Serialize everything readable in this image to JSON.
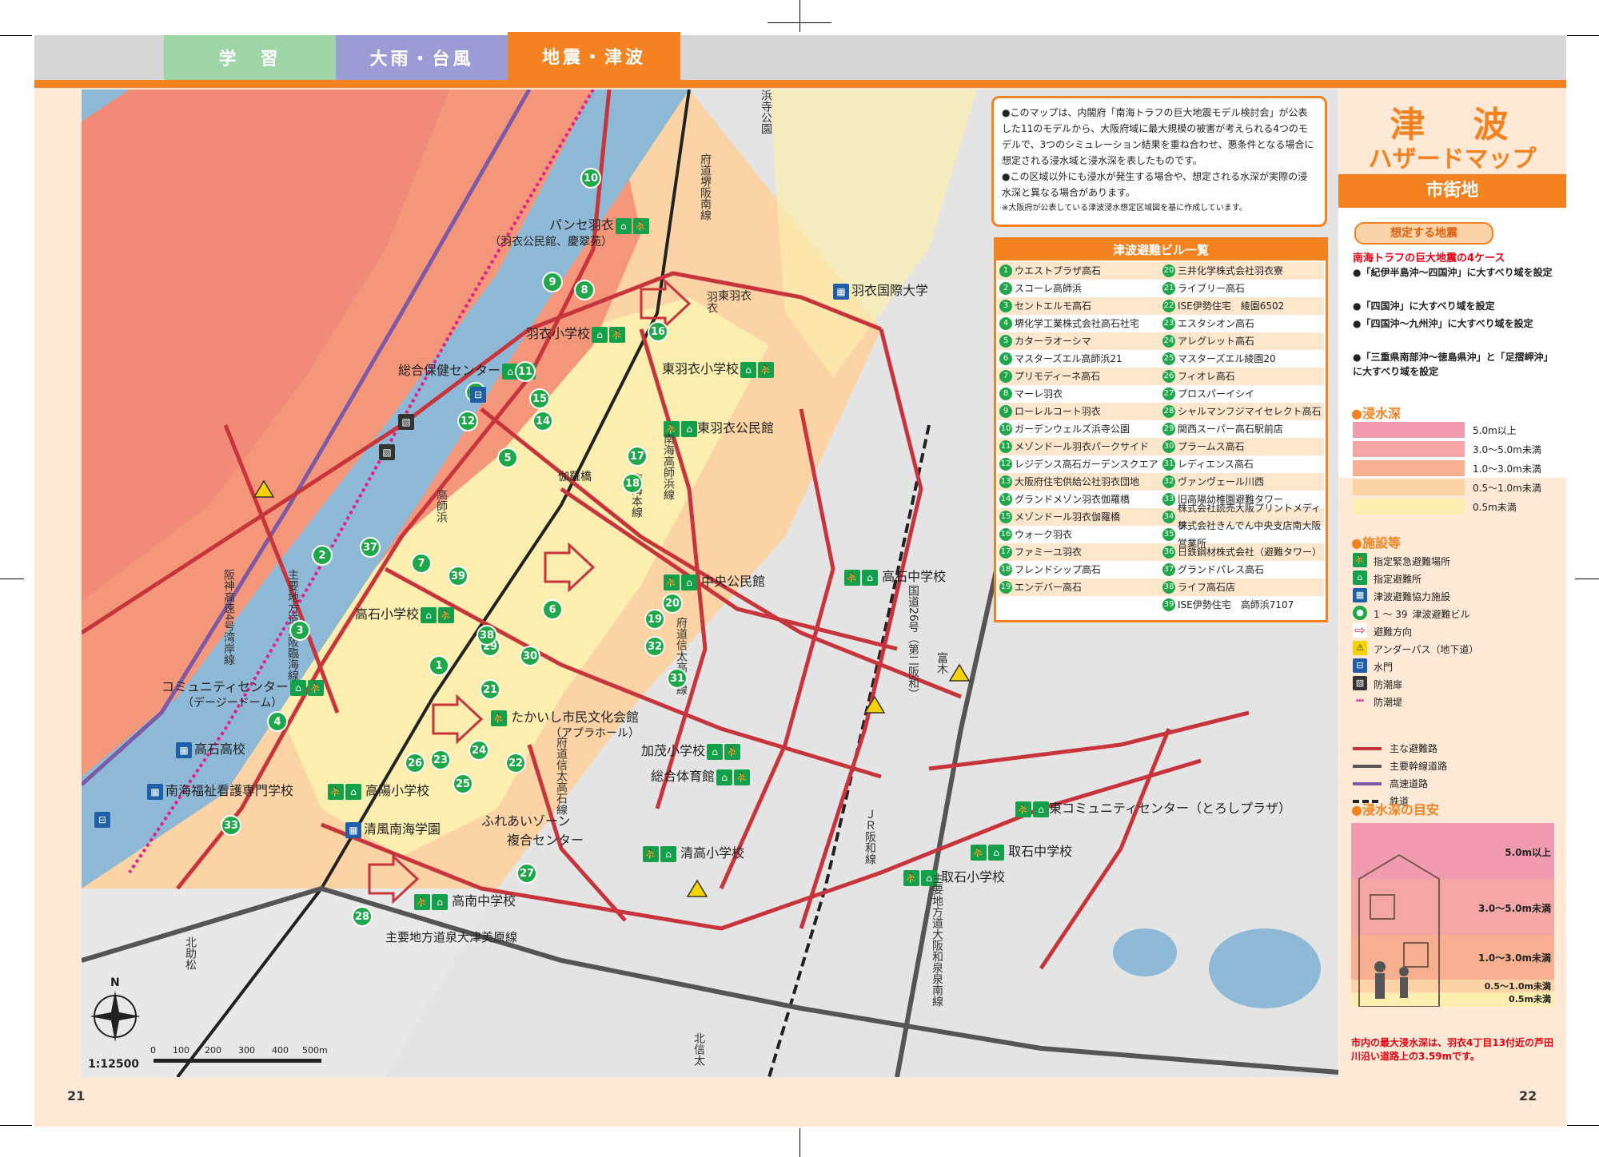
{
  "tabs": [
    {
      "label": "学　習",
      "color": "#9fd5a6"
    },
    {
      "label": "大雨・台風",
      "color": "#9b9bd6"
    },
    {
      "label": "地震・津波",
      "color": "#f58220"
    }
  ],
  "page_numbers": {
    "left": "21",
    "right": "22"
  },
  "map": {
    "scale_label": "1:12500",
    "scale_ticks": [
      "0",
      "100",
      "200",
      "300",
      "400",
      "500m"
    ],
    "compass_label": "N",
    "colors": {
      "depth_5plus": "#f19bb0",
      "depth_3_5": "#f4a6a6",
      "depth_1_3": "#f6b08f",
      "depth_05_1": "#fcd3a4",
      "depth_lt05": "#fbeeae",
      "water": "#8db8d6",
      "road_main": "#c8343c",
      "road_trunk": "#555555",
      "highway": "#7d5aa6"
    },
    "facilities": [
      {
        "name": "パンセ羽衣",
        "sub": "（羽衣公民館、慶翠苑）"
      },
      {
        "name": "羽衣小学校"
      },
      {
        "name": "総合保健センター"
      },
      {
        "name": "東羽衣小学校"
      },
      {
        "name": "東羽衣公民館"
      },
      {
        "name": "羽衣国際大学"
      },
      {
        "name": "高石小学校"
      },
      {
        "name": "中央公民館"
      },
      {
        "name": "高石中学校"
      },
      {
        "name": "コミュニティセンター",
        "sub": "（デージードーム）"
      },
      {
        "name": "たかいし市民文化会館",
        "sub": "（アプラホール）"
      },
      {
        "name": "高石高校"
      },
      {
        "name": "南海福祉看護専門学校"
      },
      {
        "name": "高陽小学校"
      },
      {
        "name": "加茂小学校"
      },
      {
        "name": "総合体育館"
      },
      {
        "name": "清風南海学園"
      },
      {
        "name": "ふれあいゾーン",
        "sub": "複合センター"
      },
      {
        "name": "清高小学校"
      },
      {
        "name": "東コミュニティセンター（とろしプラザ）"
      },
      {
        "name": "取石中学校"
      },
      {
        "name": "取石小学校"
      },
      {
        "name": "高南中学校"
      }
    ],
    "roads": [
      "浜寺公園",
      "府道堺阪南線",
      "東羽衣",
      "羽衣",
      "南海高師浜線",
      "伽羅橋",
      "高師浜",
      "南海本線",
      "主要地方道大阪臨海線",
      "阪神高速4号湾岸線",
      "府道信太高石線",
      "府道信太高石線",
      "国道26号（第二阪和）",
      "富木",
      "ＪＲ阪和線",
      "主要地方道大阪和泉泉南線",
      "主要地方道泉大津美原線",
      "北助松",
      "北信太"
    ],
    "markers": [
      "1",
      "2",
      "3",
      "4",
      "5",
      "6",
      "7",
      "8",
      "9",
      "10",
      "11",
      "12",
      "13",
      "14",
      "15",
      "16",
      "17",
      "18",
      "19",
      "20",
      "21",
      "22",
      "23",
      "24",
      "25",
      "26",
      "27",
      "28",
      "29",
      "30",
      "31",
      "32",
      "33",
      "37",
      "38",
      "39"
    ]
  },
  "info": {
    "lines": [
      "●このマップは、内閣府「南海トラフの巨大地震モデル検討会」が公表した11のモデルから、大阪府域に最大規模の被害が考えられる4つのモデルで、3つのシミュレーション結果を重ね合わせ、悪条件となる場合に想定される浸水域と浸水深を表したものです。",
      "●この区域以外にも浸水が発生する場合や、想定される水深が実際の浸水深と異なる場合があります。"
    ],
    "note": "※大阪府が公表している津波浸水想定区域図を基に作成しています。"
  },
  "building_list": {
    "title": "津波避難ビル一覧",
    "left": [
      {
        "n": "1",
        "name": "ウエストプラザ高石"
      },
      {
        "n": "2",
        "name": "スコーレ高師浜"
      },
      {
        "n": "3",
        "name": "セントエルモ高石"
      },
      {
        "n": "4",
        "name": "堺化学工業株式会社高石社宅"
      },
      {
        "n": "5",
        "name": "カターラオーシマ"
      },
      {
        "n": "6",
        "name": "マスターズエル高師浜21"
      },
      {
        "n": "7",
        "name": "プリモディーネ高石"
      },
      {
        "n": "8",
        "name": "マーレ羽衣"
      },
      {
        "n": "9",
        "name": "ローレルコート羽衣"
      },
      {
        "n": "10",
        "name": "ガーデンウェルズ浜寺公園"
      },
      {
        "n": "11",
        "name": "メゾンドール羽衣パークサイド"
      },
      {
        "n": "12",
        "name": "レジデンス高石ガーデンスクエア"
      },
      {
        "n": "13",
        "name": "大阪府住宅供給公社羽衣団地"
      },
      {
        "n": "14",
        "name": "グランドメゾン羽衣伽羅橋"
      },
      {
        "n": "15",
        "name": "メゾンドール羽衣伽羅橋"
      },
      {
        "n": "16",
        "name": "ウォーク羽衣"
      },
      {
        "n": "17",
        "name": "ファミーユ羽衣"
      },
      {
        "n": "18",
        "name": "フレンドシップ高石"
      },
      {
        "n": "19",
        "name": "エンデバー高石"
      }
    ],
    "right": [
      {
        "n": "20",
        "name": "三井化学株式会社羽衣寮"
      },
      {
        "n": "21",
        "name": "ライブリー高石"
      },
      {
        "n": "22",
        "name": "ISE伊勢住宅　綾園6502"
      },
      {
        "n": "23",
        "name": "エスタシオン高石"
      },
      {
        "n": "24",
        "name": "アレグレット高石"
      },
      {
        "n": "25",
        "name": "マスターズエル綾園20"
      },
      {
        "n": "26",
        "name": "フィオレ高石"
      },
      {
        "n": "27",
        "name": "プロスパーイシイ"
      },
      {
        "n": "28",
        "name": "シャルマンフジマイセレクト高石"
      },
      {
        "n": "29",
        "name": "関西スーパー高石駅前店"
      },
      {
        "n": "30",
        "name": "プラームス高石"
      },
      {
        "n": "31",
        "name": "レディエンス高石"
      },
      {
        "n": "32",
        "name": "ヴァンヴェール川西"
      },
      {
        "n": "33",
        "name": "旧高陽幼稚園避難タワー"
      },
      {
        "n": "34",
        "name": "株式会社読売大阪プリントメディア"
      },
      {
        "n": "35",
        "name": "株式会社きんでん中央支店南大阪営業所"
      },
      {
        "n": "36",
        "name": "日鉄鋼材株式会社（避難タワー）"
      },
      {
        "n": "37",
        "name": "グランドパレス高石"
      },
      {
        "n": "38",
        "name": "ライフ高石店"
      },
      {
        "n": "39",
        "name": "ISE伊勢住宅　高師浜7107"
      }
    ]
  },
  "side": {
    "title": "津　波",
    "subtitle": "ハザードマップ",
    "band": "市街地",
    "pill": "想定する地震",
    "quake_title": "南海トラフの巨大地震の4ケース",
    "quake_items": [
      "●「紀伊半島沖〜四国沖」に大すべり域を設定",
      "●「四国沖」に大すべり域を設定",
      "●「四国沖〜九州沖」に大すべり域を設定",
      "●「三重県南部沖〜徳島県沖」と「足摺岬沖」に大すべり域を設定"
    ],
    "depth_head": "●浸水深",
    "depth_legend": [
      {
        "label": "5.0m以上",
        "color": "#f19bb0"
      },
      {
        "label": "3.0〜5.0m未満",
        "color": "#f4a6a6"
      },
      {
        "label": "1.0〜3.0m未満",
        "color": "#f6b08f"
      },
      {
        "label": "0.5〜1.0m未満",
        "color": "#fcd3a4"
      },
      {
        "label": "0.5m未満",
        "color": "#fbeeae"
      }
    ],
    "facility_head": "●施設等",
    "facility_legend": [
      {
        "label": "指定緊急避難場所",
        "icon": "shelter-emergency-icon"
      },
      {
        "label": "指定避難所",
        "icon": "shelter-icon"
      },
      {
        "label": "津波避難協力施設",
        "icon": "cooperation-facility-icon"
      },
      {
        "label": "津波避難ビル",
        "icon": "evacuation-building-icon",
        "prefix": "1 〜 39"
      },
      {
        "label": "避難方向",
        "icon": "direction-arrow-icon"
      },
      {
        "label": "アンダーパス（地下道）",
        "icon": "warning-triangle-icon"
      },
      {
        "label": "水門",
        "icon": "water-gate-icon"
      },
      {
        "label": "防潮扉",
        "icon": "tide-door-icon"
      },
      {
        "label": "防潮堤",
        "icon": "seawall-icon"
      }
    ],
    "line_legend": [
      {
        "label": "主な避難路",
        "color": "#c8343c"
      },
      {
        "label": "主要幹線道路",
        "color": "#555555"
      },
      {
        "label": "高速道路",
        "color": "#7d5aa6"
      },
      {
        "label": "鉄道",
        "color": "#222222"
      }
    ],
    "guide_head": "●浸水深の目安",
    "guide_levels": [
      "5.0m以上",
      "3.0〜5.0m未満",
      "1.0〜3.0m未満",
      "0.5〜1.0m未満",
      "0.5m未満"
    ],
    "max_note": "市内の最大浸水深は、羽衣4丁目13付近の芦田川沿い道路上の3.59mです。"
  }
}
